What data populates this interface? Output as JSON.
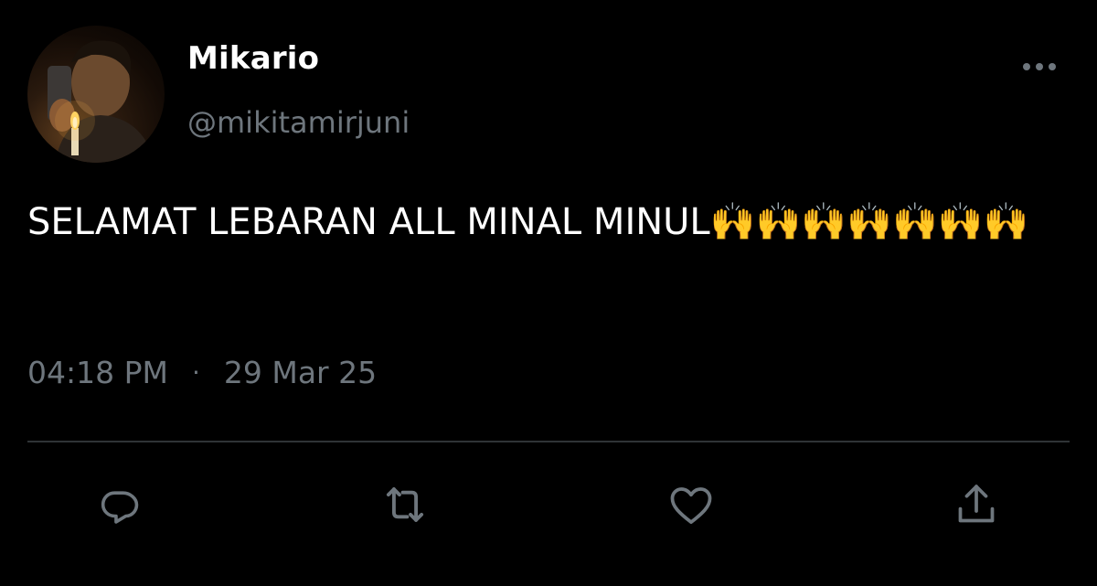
{
  "author": {
    "display_name": "Mikario",
    "handle": "@mikitamirjuni"
  },
  "tweet": {
    "text": "SELAMAT LEBARAN ALL MINAL MINUL🙌🙌🙌🙌🙌🙌🙌",
    "time": "04:18 PM",
    "separator": "·",
    "date": "29 Mar 25"
  },
  "icons": {
    "more": "more-dots-icon",
    "reply": "reply-icon",
    "retweet": "retweet-icon",
    "like": "heart-icon",
    "share": "share-icon"
  },
  "colors": {
    "background": "#000000",
    "text": "#ffffff",
    "secondary": "#6e767d",
    "divider": "#2f3336"
  }
}
